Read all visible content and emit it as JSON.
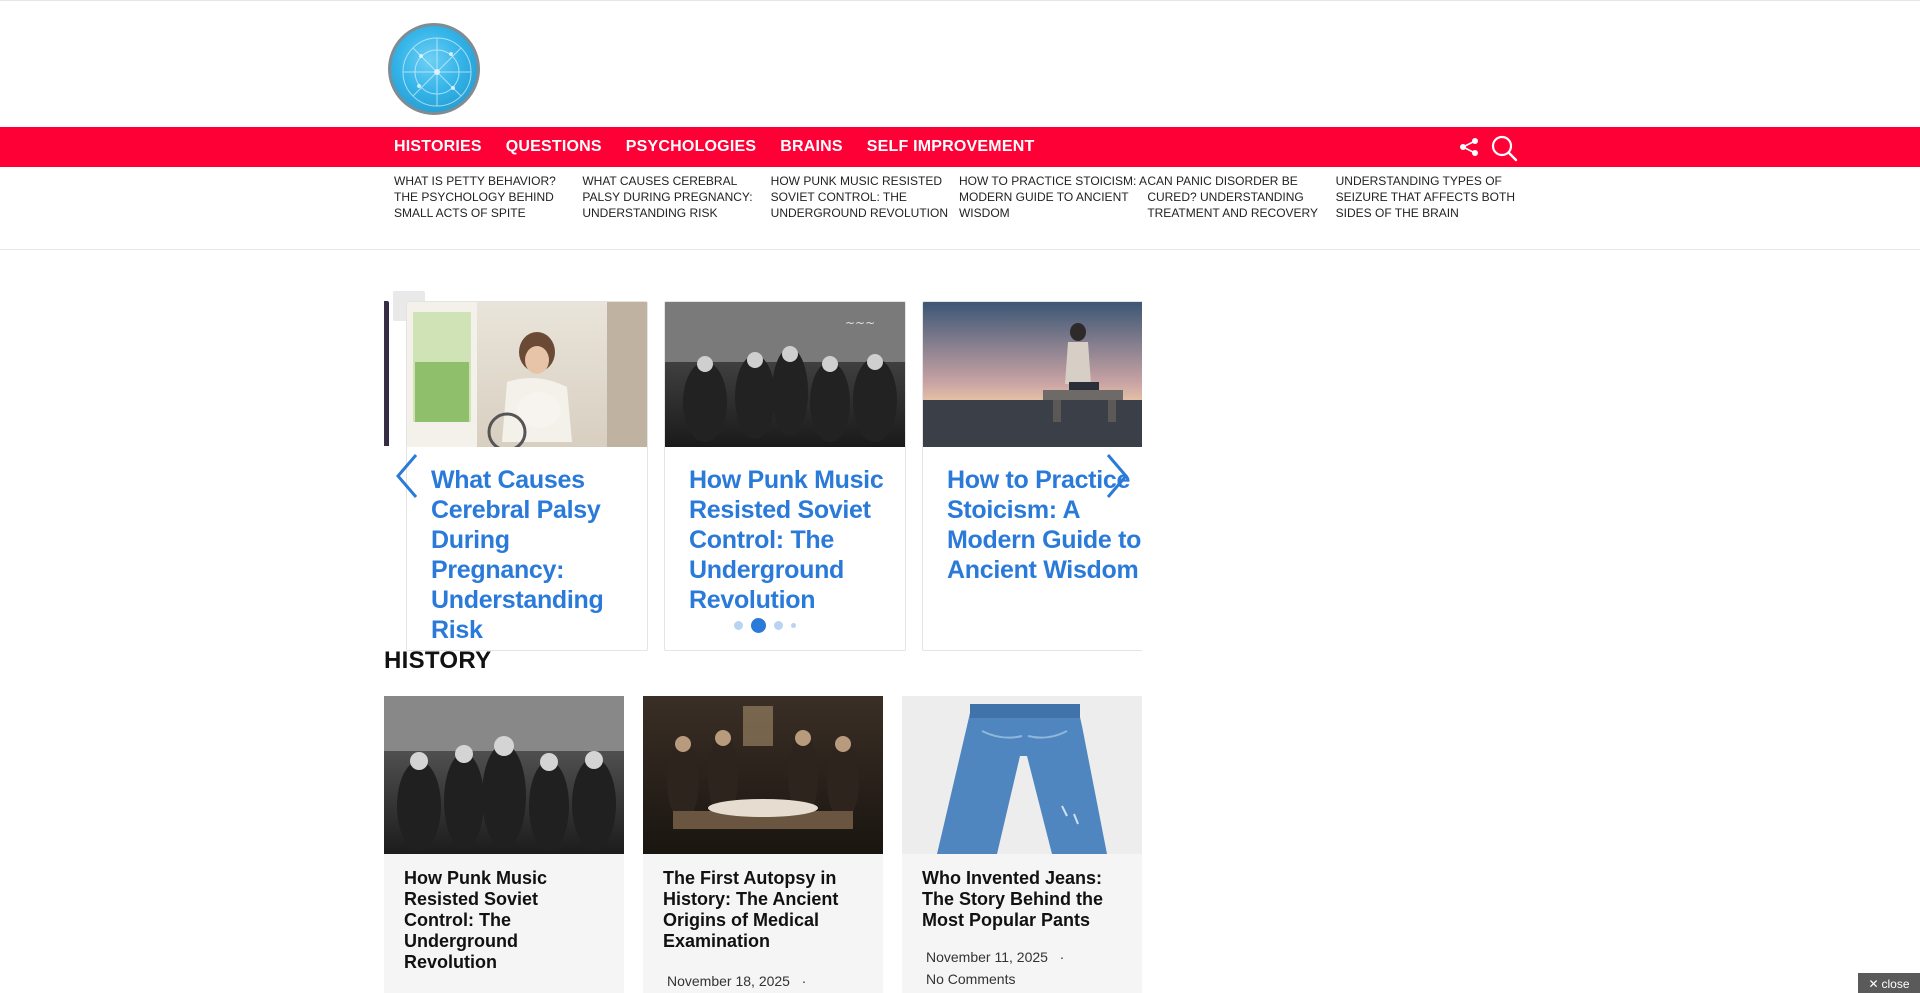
{
  "nav": {
    "items": [
      "HISTORIES",
      "QUESTIONS",
      "PSYCHOLOGIES",
      "BRAINS",
      "SELF IMPROVEMENT"
    ]
  },
  "trending": [
    "What Is Petty Behavior? The Psychology Behind Small Acts of Spite",
    "What Causes Cerebral Palsy During Pregnancy: Understanding Risk",
    "How Punk Music Resisted Soviet Control: The Underground Revolution",
    "How to Practice Stoicism: A Modern Guide to Ancient Wisdom",
    "Can Panic Disorder Be Cured? Understanding Treatment and Recovery",
    "Understanding Types of Seizure That Affects Both Sides of the Brain"
  ],
  "carousel": {
    "slides": [
      "What Causes Cerebral Palsy During Pregnancy: Understanding Risk",
      "How Punk Music Resisted Soviet Control: The Underground Revolution",
      "How to Practice Stoicism: A Modern Guide to Ancient Wisdom"
    ],
    "active_dot": 2,
    "dot_count": 4
  },
  "history": {
    "title": "HISTORY",
    "cards": [
      {
        "title": "How Punk Music Resisted Soviet Control: The Underground Revolution",
        "date": "",
        "comments": ""
      },
      {
        "title": "The First Autopsy in History: The Ancient Origins of Medical Examination",
        "date": "November 18, 2025",
        "comments": ""
      },
      {
        "title": "Who Invented Jeans: The Story Behind the Most Popular Pants",
        "date": "November 11, 2025",
        "comments": "No Comments"
      }
    ]
  },
  "close_label": "close",
  "colors": {
    "nav_bg": "#ff0036",
    "link_blue": "#2a7ad9"
  }
}
